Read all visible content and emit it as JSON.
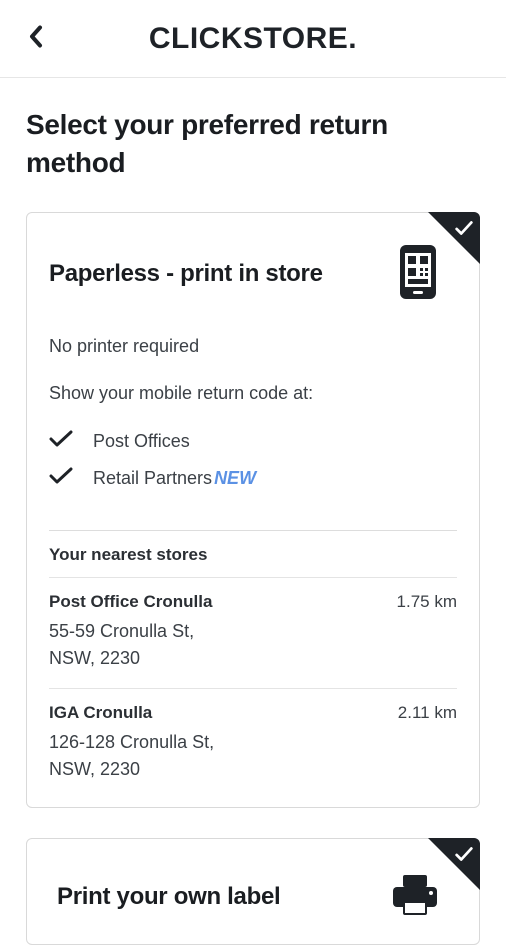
{
  "header": {
    "logo": "CLICKSTORE."
  },
  "page": {
    "title": "Select your preferred return method"
  },
  "option1": {
    "title": "Paperless - print in store",
    "sub1": "No printer required",
    "sub2": "Show your mobile return code at:",
    "check_items": [
      {
        "label": "Post Offices",
        "badge": ""
      },
      {
        "label": "Retail Partners",
        "badge": "NEW"
      }
    ],
    "stores_heading": "Your nearest stores",
    "stores": [
      {
        "name": "Post Office Cronulla",
        "line1": "55-59 Cronulla St,",
        "line2": "NSW, 2230",
        "distance": "1.75 km"
      },
      {
        "name": "IGA Cronulla",
        "line1": "126-128 Cronulla St,",
        "line2": "NSW, 2230",
        "distance": "2.11 km"
      }
    ]
  },
  "option2": {
    "title": "Print your own label"
  }
}
